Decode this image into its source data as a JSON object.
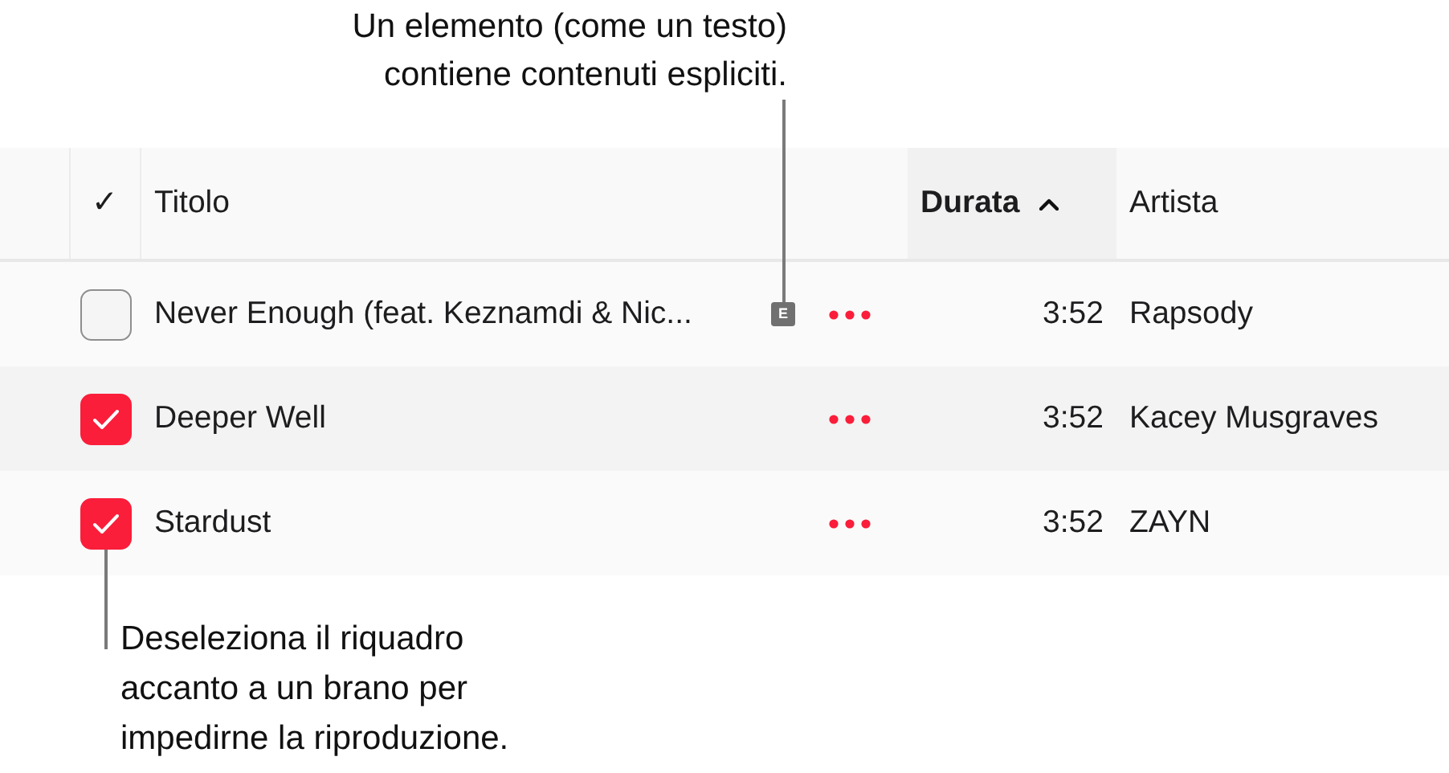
{
  "callouts": [
    {
      "kind": "top",
      "text": "Un elemento (come un testo)\ncontiene contenuti espliciti."
    },
    {
      "kind": "bottom",
      "text": "Deseleziona il riquadro\naccanto a un brano per\nimpedirne la riproduzione."
    }
  ],
  "table": {
    "columns": [
      {
        "kind": "check",
        "label": "✓",
        "sorted": false
      },
      {
        "kind": "title",
        "label": "Titolo",
        "sorted": false
      },
      {
        "kind": "duration",
        "label": "Durata",
        "sorted": true
      },
      {
        "kind": "artist",
        "label": "Artista",
        "sorted": false
      }
    ],
    "rows": [
      {
        "checked": false,
        "title": "Never Enough (feat. Keznamdi & Nic...",
        "explicit": "E",
        "duration": "3:52",
        "artist": "Rapsody"
      },
      {
        "checked": true,
        "title": "Deeper Well",
        "duration": "3:52",
        "artist": "Kacey Musgraves"
      },
      {
        "checked": true,
        "title": "Stardust",
        "duration": "3:52",
        "artist": "ZAYN"
      }
    ]
  }
}
